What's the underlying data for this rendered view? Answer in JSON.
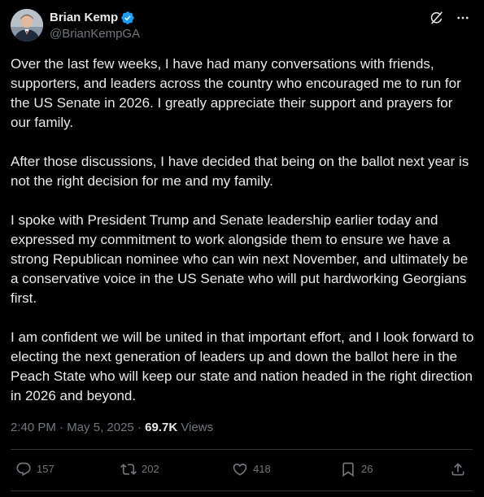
{
  "author": {
    "display_name": "Brian Kemp",
    "handle": "@BrianKempGA",
    "verified": true,
    "verified_color": "#1d9bf0"
  },
  "icons": {
    "avatar": "profile-photo",
    "verified": "verified-badge-icon",
    "grok": "grok-icon",
    "more": "more-horizontal-icon",
    "reply": "reply-icon",
    "repost": "repost-icon",
    "like": "like-icon",
    "bookmark": "bookmark-icon",
    "share": "share-icon"
  },
  "tweet": {
    "paragraphs": [
      "Over the last few weeks, I have had many conversations with friends, supporters, and leaders across the country who encouraged me to run for the US Senate in 2026. I greatly appreciate their support and prayers for our family.",
      "After those discussions, I have decided that being on the ballot next year is not the right decision for me and my family.",
      "I spoke with President Trump and Senate leadership earlier today and expressed my commitment to work alongside them to ensure we have a strong Republican nominee who can win next November, and ultimately be a conservative voice in the US Senate who will put hardworking Georgians first.",
      "I am confident we will be united in that important effort, and I look forward to electing the next generation of leaders up and down the ballot here in the Peach State who will keep our state and nation headed in the right direction in 2026 and beyond."
    ],
    "time": "2:40 PM",
    "separator": "·",
    "date": "May 5, 2025",
    "views_count": "69.7K",
    "views_label": "Views"
  },
  "engagement": {
    "replies": "157",
    "reposts": "202",
    "likes": "418",
    "bookmarks": "26"
  },
  "colors": {
    "background": "#000000",
    "text": "#e7e9ea",
    "secondary": "#71767b",
    "divider": "#2f3336"
  }
}
